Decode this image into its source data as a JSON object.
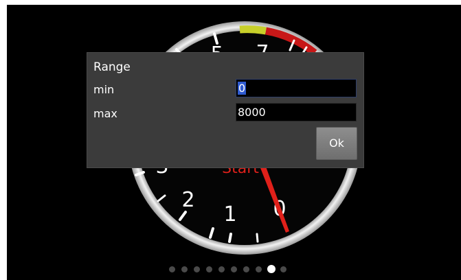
{
  "gauge": {
    "tick_labels": [
      "0",
      "1",
      "2",
      "3",
      "5",
      "7"
    ],
    "center_label": "Start",
    "colors": {
      "needle": "#e0201a",
      "label": "#e0201a",
      "yellow_zone": "#c8d02a",
      "red_zone": "#c81818"
    }
  },
  "dialog": {
    "title": "Range",
    "min_label": "min",
    "min_value": "0",
    "max_label": "max",
    "max_value": "8000",
    "ok_label": "Ok"
  },
  "pager": {
    "total_pages": 10,
    "current_page": 9
  }
}
